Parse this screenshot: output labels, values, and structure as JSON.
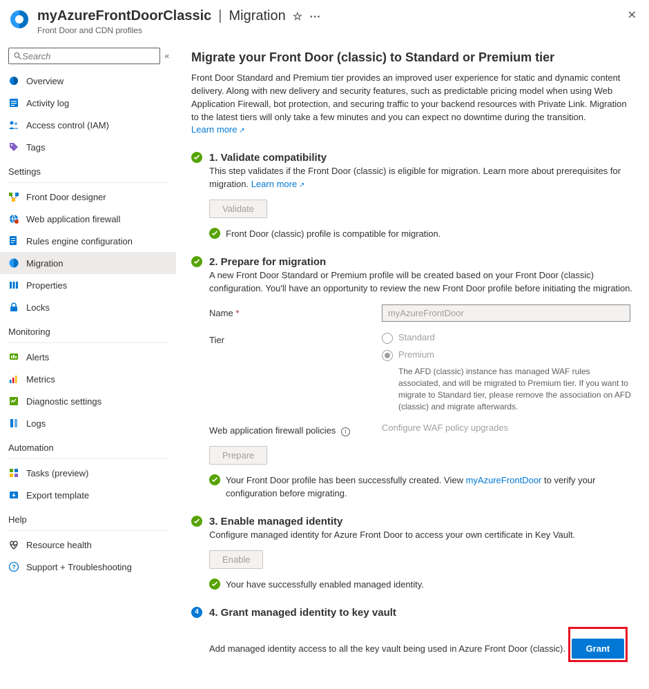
{
  "header": {
    "title_left": "myAzureFrontDoorClassic",
    "title_right": "Migration",
    "subtitle": "Front Door and CDN profiles"
  },
  "search": {
    "placeholder": "Search"
  },
  "nav": {
    "top": [
      {
        "label": "Overview",
        "icon": "overview"
      },
      {
        "label": "Activity log",
        "icon": "activity"
      },
      {
        "label": "Access control (IAM)",
        "icon": "iam"
      },
      {
        "label": "Tags",
        "icon": "tags"
      }
    ],
    "groups": [
      {
        "title": "Settings",
        "items": [
          {
            "label": "Front Door designer",
            "icon": "designer"
          },
          {
            "label": "Web application firewall",
            "icon": "waf"
          },
          {
            "label": "Rules engine configuration",
            "icon": "rules"
          },
          {
            "label": "Migration",
            "icon": "migration",
            "selected": true
          },
          {
            "label": "Properties",
            "icon": "properties"
          },
          {
            "label": "Locks",
            "icon": "locks"
          }
        ]
      },
      {
        "title": "Monitoring",
        "items": [
          {
            "label": "Alerts",
            "icon": "alerts"
          },
          {
            "label": "Metrics",
            "icon": "metrics"
          },
          {
            "label": "Diagnostic settings",
            "icon": "diag"
          },
          {
            "label": "Logs",
            "icon": "logs"
          }
        ]
      },
      {
        "title": "Automation",
        "items": [
          {
            "label": "Tasks (preview)",
            "icon": "tasks"
          },
          {
            "label": "Export template",
            "icon": "export"
          }
        ]
      },
      {
        "title": "Help",
        "items": [
          {
            "label": "Resource health",
            "icon": "health"
          },
          {
            "label": "Support + Troubleshooting",
            "icon": "support"
          }
        ]
      }
    ]
  },
  "main": {
    "title": "Migrate your Front Door (classic) to Standard or Premium tier",
    "intro": "Front Door Standard and Premium tier provides an improved user experience for static and dynamic content delivery. Along with new delivery and security features, such as predictable pricing model when using Web Application Firewall, bot protection, and securing traffic to your backend resources with Private Link. Migration to the latest tiers will only take a few minutes and you can expect no downtime during the transition.",
    "learn_more": "Learn more",
    "step1": {
      "title": "1. Validate compatibility",
      "desc": "This step validates if the Front Door (classic) is eligible for migration. Learn more about prerequisites for migration.",
      "learn_more": "Learn more",
      "button": "Validate",
      "status": "Front Door (classic) profile is compatible for migration."
    },
    "step2": {
      "title": "2. Prepare for migration",
      "desc": "A new Front Door Standard or Premium profile will be created based on your Front Door (classic) configuration. You'll have an opportunity to review the new Front Door profile before initiating the migration.",
      "name_label": "Name",
      "name_value": "myAzureFrontDoor",
      "tier_label": "Tier",
      "tier_standard": "Standard",
      "tier_premium": "Premium",
      "tier_note": "The AFD (classic) instance has managed WAF rules associated, and will be migrated to Premium tier. If you want to migrate to Standard tier, please remove the association on AFD (classic) and migrate afterwards.",
      "waf_label": "Web application firewall policies",
      "waf_link": "Configure WAF policy upgrades",
      "button": "Prepare",
      "status_pre": "Your Front Door profile has been successfully created. View ",
      "status_link": "myAzureFrontDoor",
      "status_post": " to verify your configuration before migrating."
    },
    "step3": {
      "title": "3. Enable managed identity",
      "desc": "Configure managed identity for Azure Front Door to access your own certificate in Key Vault.",
      "button": "Enable",
      "status": "Your have successfully enabled managed identity."
    },
    "step4": {
      "num": "4",
      "title": "4. Grant managed identity to key vault",
      "desc": "Add managed identity access to all the key vault being used in Azure Front Door (classic).",
      "button": "Grant"
    }
  }
}
